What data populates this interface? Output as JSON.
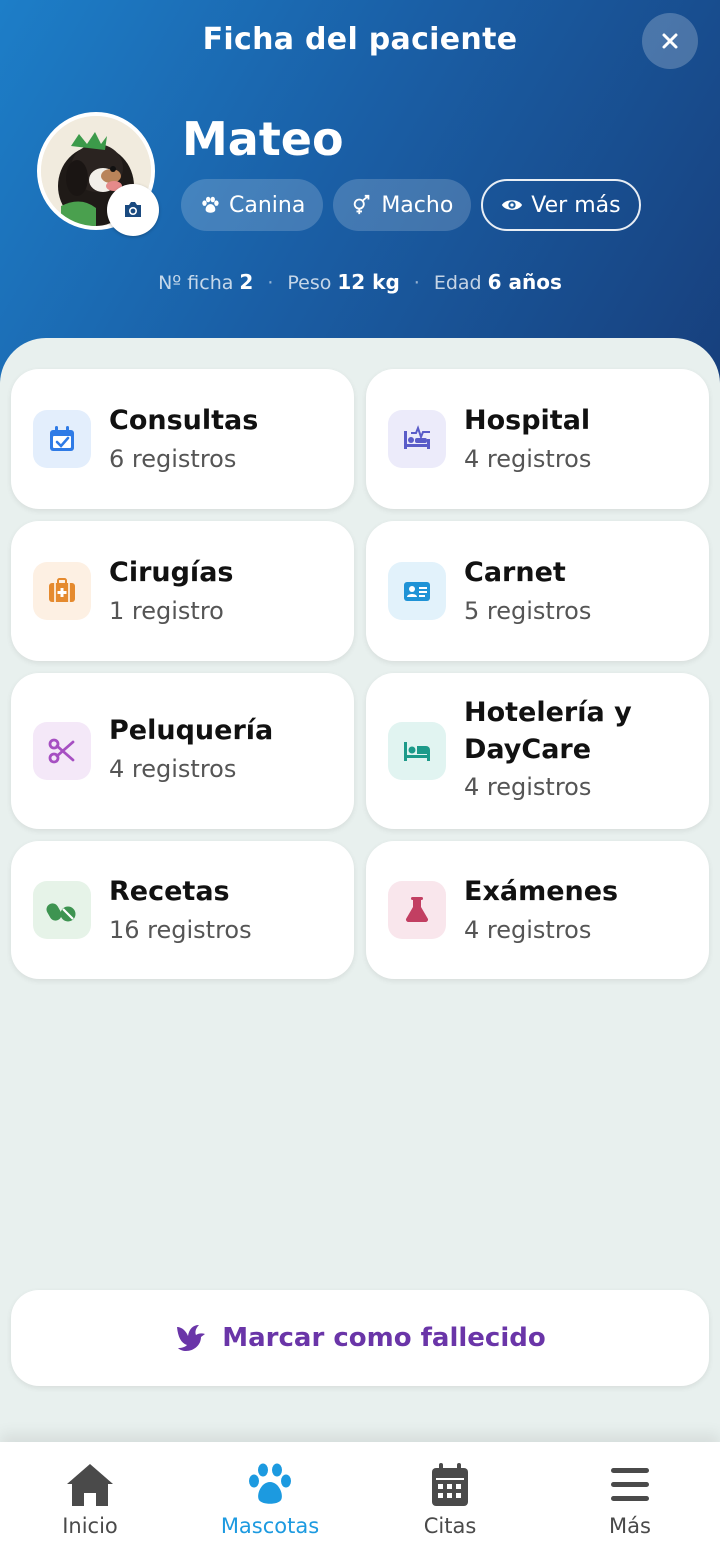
{
  "header": {
    "title": "Ficha del paciente",
    "close_icon": "close-icon"
  },
  "patient": {
    "name": "Mateo",
    "chips": {
      "species": "Canina",
      "sex": "Macho",
      "more": "Ver más"
    },
    "stats": {
      "ficha_label": "Nº ficha",
      "ficha_value": "2",
      "peso_label": "Peso",
      "peso_value": "12 kg",
      "edad_label": "Edad",
      "edad_value": "6 años"
    }
  },
  "sections": [
    {
      "name": "Consultas",
      "count": "6 registros",
      "icon": "calendar-check-icon",
      "color": "#2f7be6",
      "bg": "#e3eefc"
    },
    {
      "name": "Hospital",
      "count": "4 registros",
      "icon": "hospital-bed-icon",
      "color": "#5a5cc8",
      "bg": "#ecebfa"
    },
    {
      "name": "Cirugías",
      "count": "1 registro",
      "icon": "medical-kit-icon",
      "color": "#e58a2e",
      "bg": "#fdf0e3"
    },
    {
      "name": "Carnet",
      "count": "5 registros",
      "icon": "id-card-icon",
      "color": "#1f93d6",
      "bg": "#e2f2fb"
    },
    {
      "name": "Peluquería",
      "count": "4 registros",
      "icon": "scissors-icon",
      "color": "#a64fc2",
      "bg": "#f4e8f8"
    },
    {
      "name": "Hotelería y DayCare",
      "count": "4 registros",
      "icon": "bed-icon",
      "color": "#1d9a8a",
      "bg": "#e1f4f1"
    },
    {
      "name": "Recetas",
      "count": "16 registros",
      "icon": "pills-icon",
      "color": "#3e9451",
      "bg": "#e6f3e8"
    },
    {
      "name": "Exámenes",
      "count": "4 registros",
      "icon": "flask-icon",
      "color": "#c23f62",
      "bg": "#f9e6ec"
    }
  ],
  "deceased_button": {
    "label": "Marcar como fallecido",
    "icon": "dove-icon",
    "color": "#6a35a8"
  },
  "bottom_nav": [
    {
      "label": "Inicio",
      "icon": "home-icon",
      "active": false
    },
    {
      "label": "Mascotas",
      "icon": "paw-icon",
      "active": true
    },
    {
      "label": "Citas",
      "icon": "calendar-icon",
      "active": false
    },
    {
      "label": "Más",
      "icon": "menu-icon",
      "active": false
    }
  ],
  "colors": {
    "header_gradient_start": "#1d7ec8",
    "header_gradient_end": "#173f7c",
    "background": "#e8f0ee",
    "nav_active": "#1c9ae0"
  }
}
